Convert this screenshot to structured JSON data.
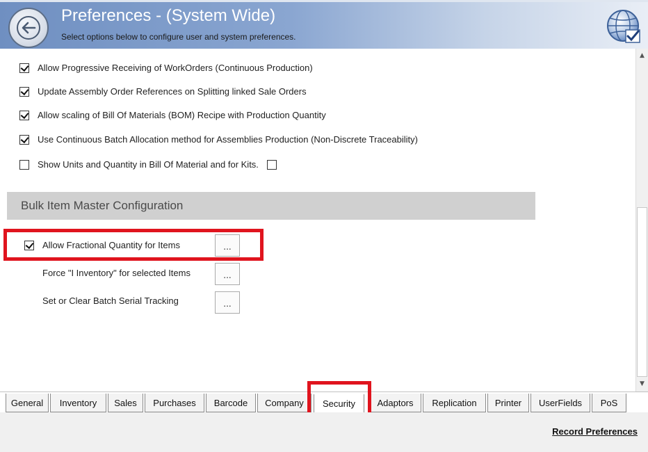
{
  "header": {
    "title": "Preferences - (System Wide)",
    "subtitle": "Select options below to configure user and system preferences."
  },
  "options": [
    {
      "label": "Allow Progressive Receiving of WorkOrders (Continuous Production)",
      "checked": true
    },
    {
      "label": "Update Assembly Order References on Splitting linked Sale Orders",
      "checked": true
    },
    {
      "label": "Allow scaling of Bill Of Materials (BOM) Recipe with Production Quantity",
      "checked": true
    },
    {
      "label": "Use Continuous Batch Allocation method for Assemblies Production (Non-Discrete Traceability)",
      "checked": true
    },
    {
      "label": "Show Units and Quantity in Bill Of Material and for Kits.",
      "checked": false,
      "trailing_checkbox_checked": false
    }
  ],
  "bulk_section": {
    "title": "Bulk Item Master Configuration",
    "items": [
      {
        "label": "Allow Fractional Quantity for Items",
        "has_checkbox": true,
        "checked": true,
        "button_label": "..."
      },
      {
        "label": "Force \"I Inventory\" for selected Items",
        "has_checkbox": false,
        "button_label": "..."
      },
      {
        "label": "Set or Clear Batch Serial Tracking",
        "has_checkbox": false,
        "button_label": "..."
      }
    ]
  },
  "tabs": [
    {
      "label": "General"
    },
    {
      "label": "Inventory"
    },
    {
      "label": "Sales"
    },
    {
      "label": "Purchases"
    },
    {
      "label": "Barcode"
    },
    {
      "label": "Company"
    },
    {
      "label": "Security",
      "active": true
    },
    {
      "label": "Adaptors"
    },
    {
      "label": "Replication"
    },
    {
      "label": "Printer"
    },
    {
      "label": "UserFields"
    },
    {
      "label": "PoS"
    }
  ],
  "footer": {
    "record_link": "Record Preferences"
  },
  "colors": {
    "highlight": "#e0141e",
    "header_blue": "#6f8fc1"
  }
}
